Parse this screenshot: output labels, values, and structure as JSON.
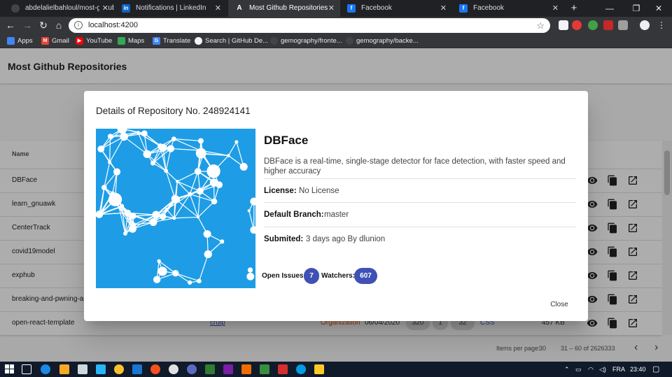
{
  "browser": {
    "tabs": [
      {
        "title": "abdelalielbahloul/most-github",
        "icon": "github-icon",
        "active": false
      },
      {
        "title": "Notifications | LinkedIn",
        "icon": "linkedin-icon",
        "active": false
      },
      {
        "title": "Most Github Repositories",
        "icon": "angular-icon",
        "active": true
      },
      {
        "title": "Facebook",
        "icon": "facebook-icon",
        "active": false
      },
      {
        "title": "Facebook",
        "icon": "facebook-icon",
        "active": false
      }
    ],
    "new_tab": "+",
    "window_controls": {
      "minimize": "—",
      "restore": "❐",
      "close": "✕"
    },
    "address": {
      "url": "localhost:4200"
    },
    "bookmarks": [
      {
        "label": "Apps",
        "icon": "apps-grid-icon"
      },
      {
        "label": "Gmail",
        "icon": "gmail-icon"
      },
      {
        "label": "YouTube",
        "icon": "youtube-icon"
      },
      {
        "label": "Maps",
        "icon": "maps-icon"
      },
      {
        "label": "Translate",
        "icon": "translate-icon"
      },
      {
        "label": "Search | GitHub De...",
        "icon": "github-icon"
      },
      {
        "label": "gemography/fronte...",
        "icon": "github-icon"
      },
      {
        "label": "gemography/backe...",
        "icon": "github-icon"
      }
    ]
  },
  "app": {
    "title": "Most Github Repositories",
    "table": {
      "column_name": "Name",
      "rows": [
        "DBFace",
        "learn_gnuawk",
        "CenterTrack",
        "covid19model",
        "exphub",
        "breaking-and-pwning-ap",
        "open-react-template"
      ],
      "last_row_extra": {
        "owner": "cruip",
        "type": "Organization",
        "date": "06/04/2020",
        "stars": "320",
        "issues": "1",
        "forks": "32",
        "language": "CSS",
        "size": "457 KB"
      }
    },
    "paginator": {
      "items_per_page_label": "Items per page:",
      "items_per_page": "30",
      "range": "31 – 60 of 2626333"
    }
  },
  "dialog": {
    "title": "Details of Repository No. 248924141",
    "repo_name": "DBFace",
    "description": "DBFace is a real-time, single-stage detector for face detection, with faster speed and higher accuracy",
    "license_label": "License:",
    "license": "No License",
    "branch_label": "Default Branch:",
    "branch": "master",
    "submitted_label": "Submited:",
    "submitted": "3 days ago By dlunion",
    "open_issues_label": "Open Issues:",
    "open_issues": "7",
    "watchers_label": "Watchers:",
    "watchers": "607",
    "close_label": "Close",
    "colors": {
      "accent": "#3f51b5",
      "image_bg": "#1e9de6"
    }
  },
  "taskbar": {
    "language": "FRA",
    "time": "23:40"
  }
}
